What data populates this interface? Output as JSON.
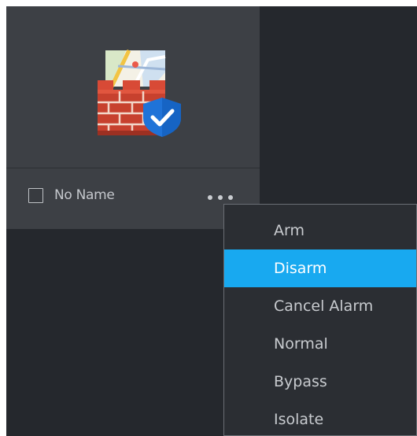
{
  "card": {
    "device_name": "No Name",
    "checked": false,
    "icon": "firewall-shield-icon"
  },
  "more_menu": {
    "icon": "more-dots-icon",
    "items": [
      {
        "label": "Arm",
        "active": false
      },
      {
        "label": "Disarm",
        "active": true
      },
      {
        "label": "Cancel Alarm",
        "active": false
      },
      {
        "label": "Normal",
        "active": false
      },
      {
        "label": "Bypass",
        "active": false
      },
      {
        "label": "Isolate",
        "active": false
      }
    ]
  },
  "colors": {
    "background": "#25282d",
    "card": "#3d4045",
    "menu": "#2b2e33",
    "accent": "#18a9f0",
    "text": "#c8cbcf"
  }
}
